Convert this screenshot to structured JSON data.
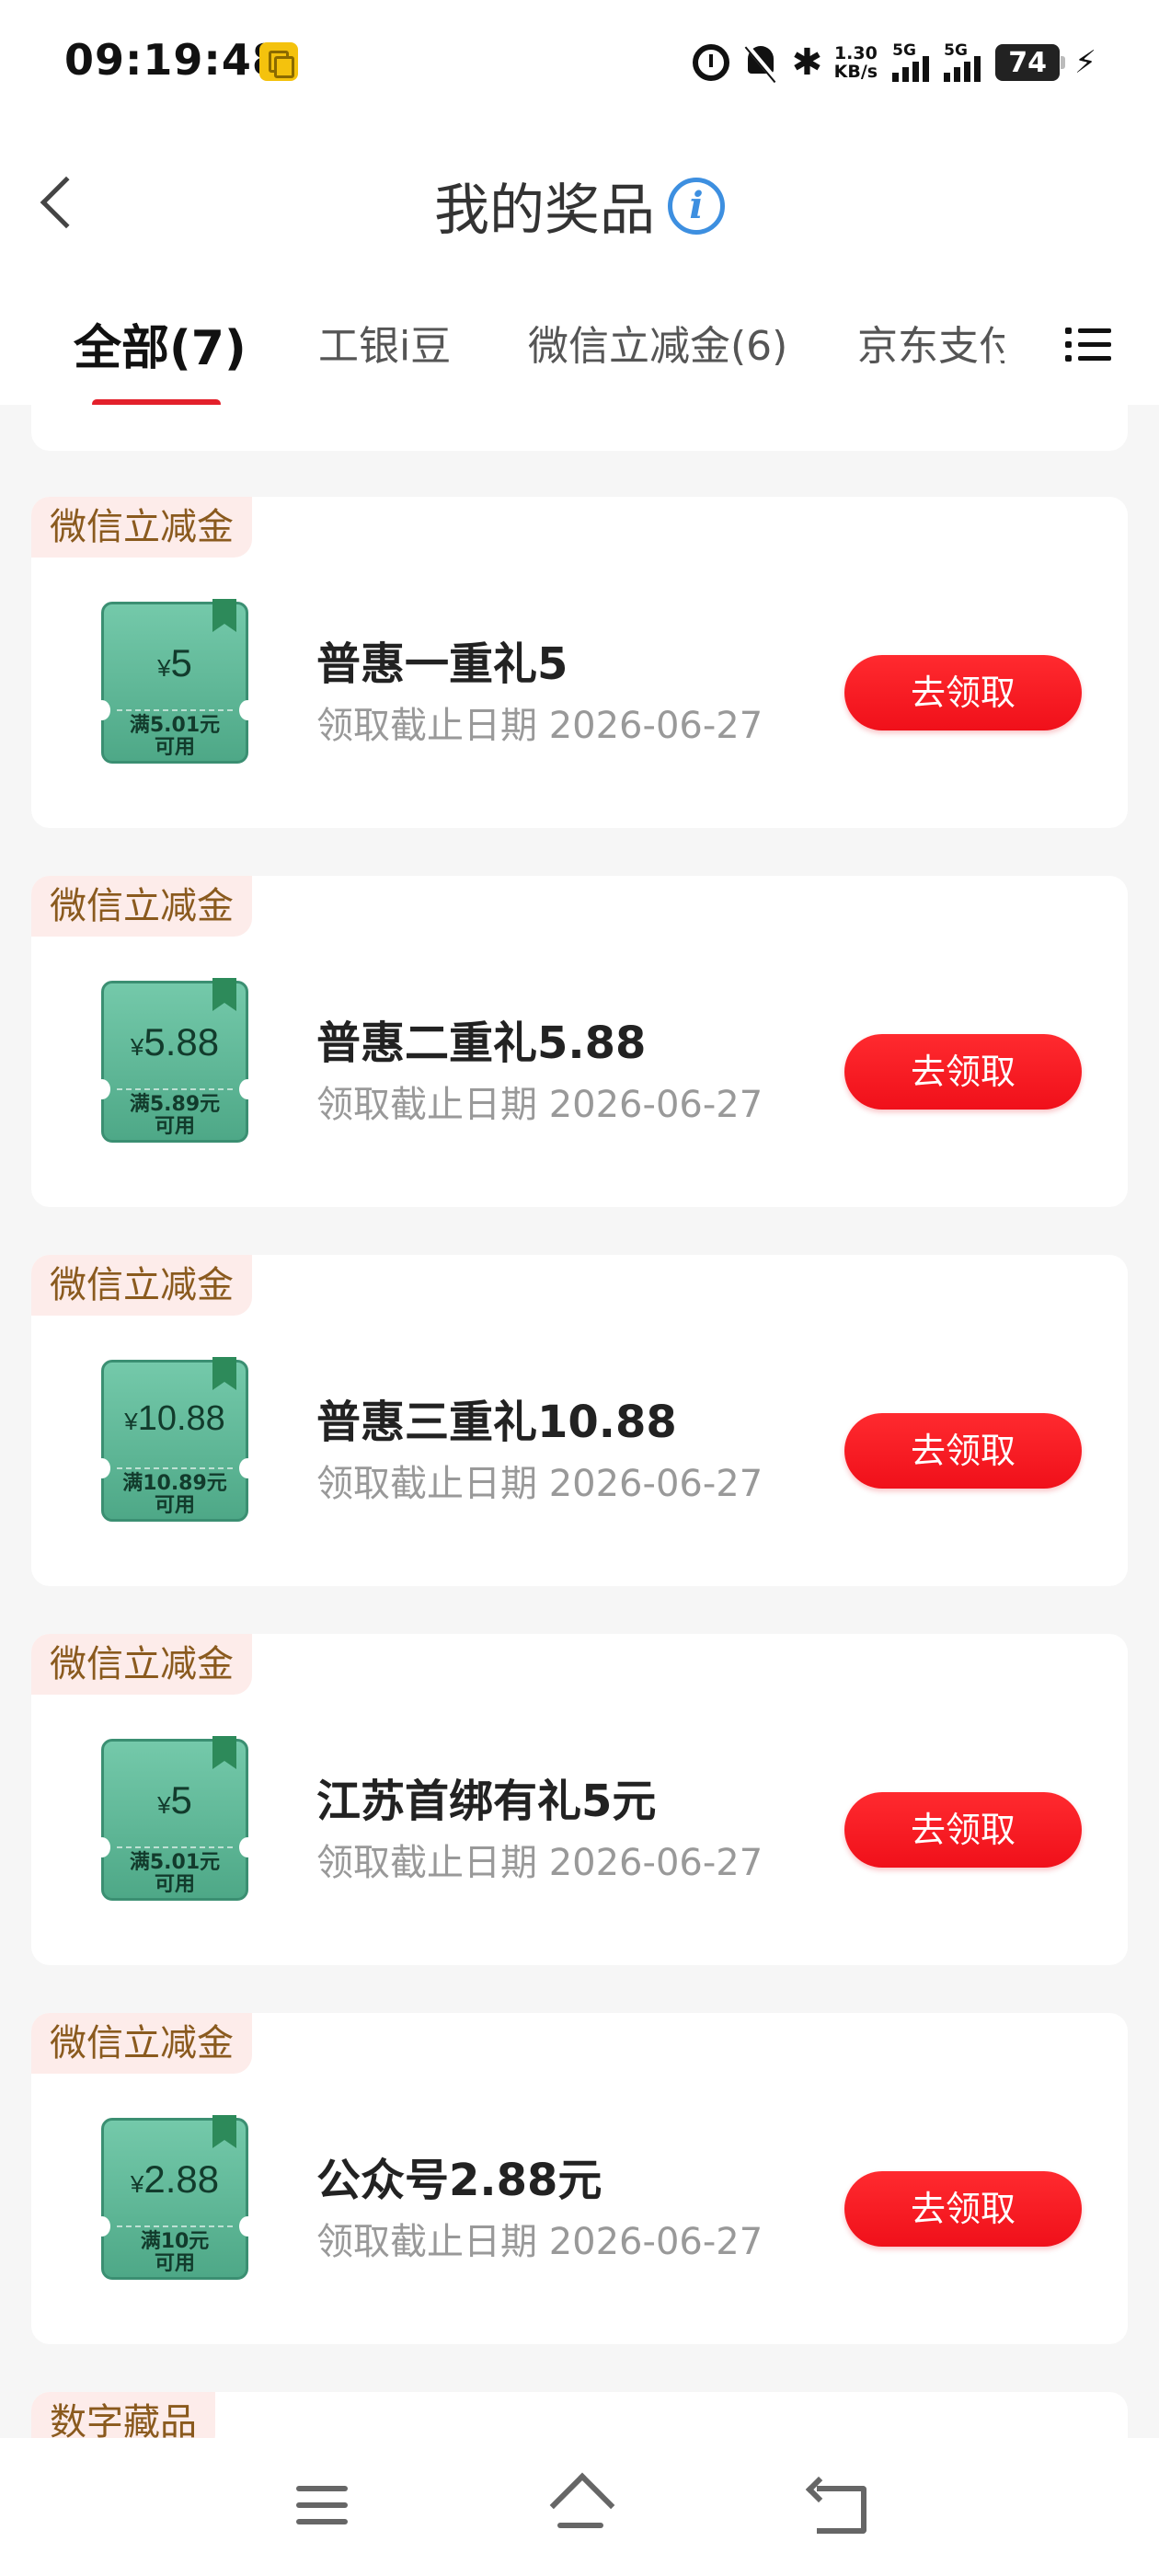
{
  "status_bar": {
    "time": "09:19:48",
    "net_speed_value": "1.30",
    "net_speed_unit": "KB/s",
    "sim1_label": "5G",
    "sim2_label": "5G",
    "battery": "74"
  },
  "header": {
    "title": "我的奖品",
    "info_glyph": "i"
  },
  "tabs": [
    {
      "label": "全部(7)",
      "active": true
    },
    {
      "label": "工银i豆",
      "active": false
    },
    {
      "label": "微信立减金(6)",
      "active": false
    },
    {
      "label": "京东支付",
      "active": false
    }
  ],
  "prizes": [
    {
      "tag": "微信立减金",
      "amount_symbol": "¥",
      "amount": "5",
      "condition_line1": "满5.01元",
      "condition_line2": "可用",
      "name": "普惠一重礼5",
      "expiry": "领取截止日期 2026-06-27",
      "button": "去领取"
    },
    {
      "tag": "微信立减金",
      "amount_symbol": "¥",
      "amount": "5.88",
      "condition_line1": "满5.89元",
      "condition_line2": "可用",
      "name": "普惠二重礼5.88",
      "expiry": "领取截止日期 2026-06-27",
      "button": "去领取"
    },
    {
      "tag": "微信立减金",
      "amount_symbol": "¥",
      "amount": "10.88",
      "condition_line1": "满10.89元",
      "condition_line2": "可用",
      "name": "普惠三重礼10.88",
      "expiry": "领取截止日期 2026-06-27",
      "button": "去领取"
    },
    {
      "tag": "微信立减金",
      "amount_symbol": "¥",
      "amount": "5",
      "condition_line1": "满5.01元",
      "condition_line2": "可用",
      "name": "江苏首绑有礼5元",
      "expiry": "领取截止日期 2026-06-27",
      "button": "去领取"
    },
    {
      "tag": "微信立减金",
      "amount_symbol": "¥",
      "amount": "2.88",
      "condition_line1": "满10元",
      "condition_line2": "可用",
      "name": "公众号2.88元",
      "expiry": "领取截止日期 2026-06-27",
      "button": "去领取"
    }
  ],
  "partial_card": {
    "tag": "数字藏品"
  },
  "colors": {
    "accent_red": "#e3202b",
    "button_red": "#f0101a",
    "coupon_green": "#4ea887",
    "tag_bg": "#fdecea",
    "tag_text": "#8a5a1e",
    "info_blue": "#3d8fe0"
  },
  "icons": {
    "back": "chevron-left-icon",
    "info": "info-icon",
    "tab_menu": "list-menu-icon",
    "nav_menu": "hamburger-icon",
    "nav_home": "home-icon",
    "nav_back": "back-arrow-icon"
  }
}
